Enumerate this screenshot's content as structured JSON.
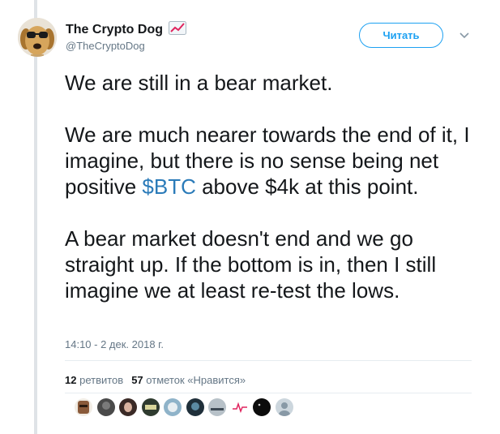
{
  "tweet": {
    "author": {
      "name": "The Crypto Dog",
      "handle": "@TheCryptoDog",
      "name_icon": "chart-increasing-icon"
    },
    "follow_label": "Читать",
    "menu_icon": "chevron-down-icon",
    "paragraphs": [
      {
        "text": "We are still in a bear market."
      },
      {
        "before": "We are much nearer towards the end of it, I imagine, but there is no sense being net positive ",
        "cashtag": "$BTC",
        "after": " above $4k at this point."
      },
      {
        "text": "A bear market doesn't end and we go straight up. If the bottom is in, then I still imagine we at least re-test the lows."
      }
    ],
    "timestamp": "14:10 - 2 дек. 2018 г.",
    "stats": {
      "retweets_count": "12",
      "retweets_label": "ретвитов",
      "likes_count": "57",
      "likes_label": "отметок «Нравится»"
    },
    "likers": [
      "liker-avatar-1",
      "liker-avatar-2",
      "liker-avatar-3",
      "liker-avatar-4",
      "liker-avatar-5",
      "liker-avatar-6",
      "liker-avatar-7",
      "liker-avatar-8",
      "liker-avatar-9",
      "liker-avatar-10"
    ]
  },
  "colors": {
    "link": "#2b7bb9",
    "follow_blue": "#1da1f2",
    "muted": "#657786",
    "text": "#14171a",
    "thread_line": "#dfe3e7"
  }
}
